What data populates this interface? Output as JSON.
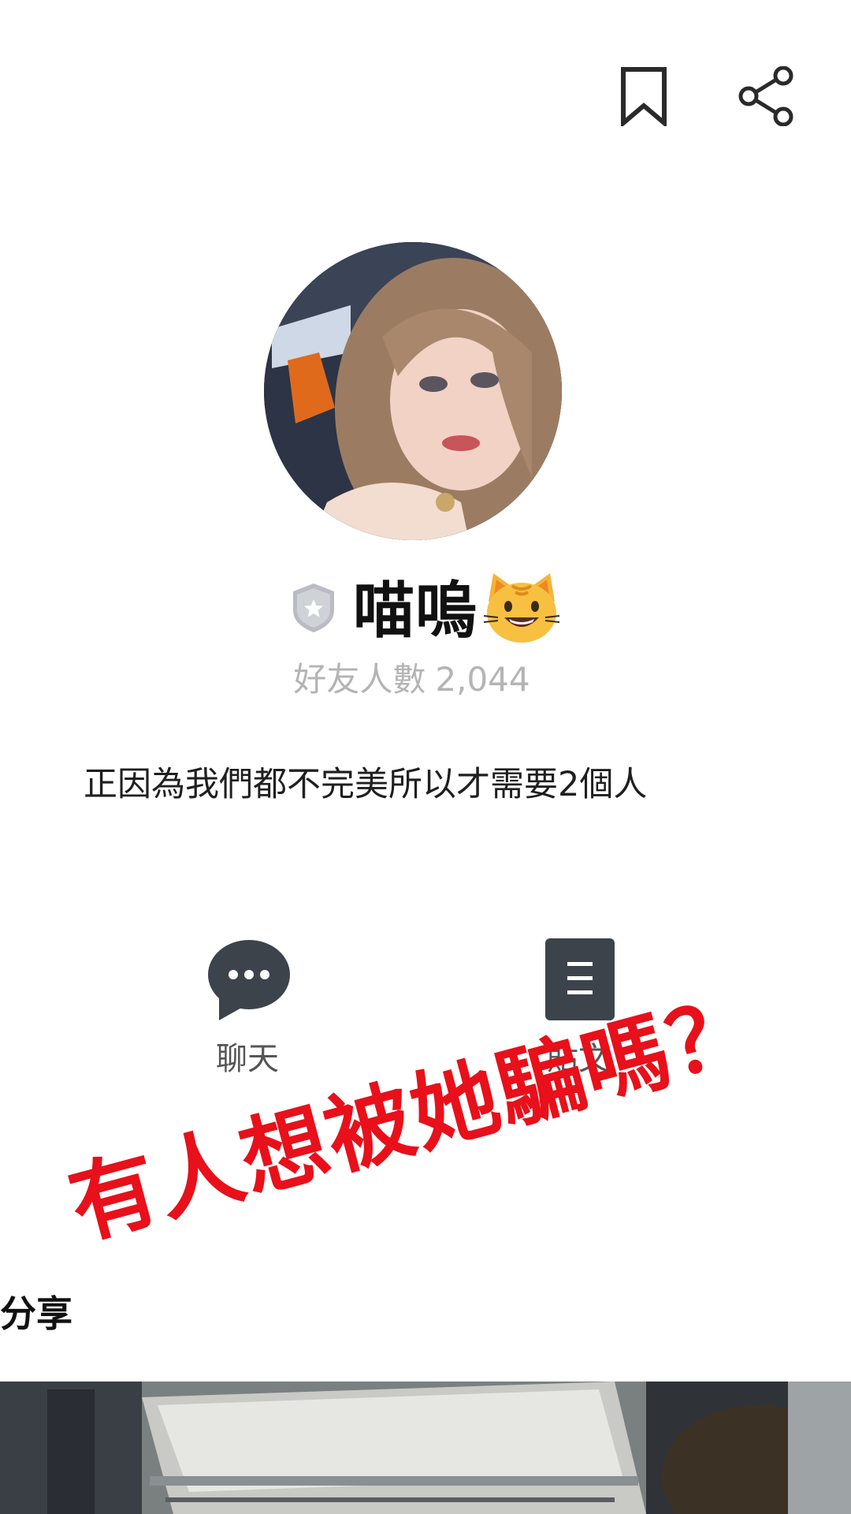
{
  "toolbar": {
    "bookmark_icon": "bookmark-icon",
    "share_icon": "share-icon"
  },
  "profile": {
    "badge_icon": "shield-star-icon",
    "name": "喵嗚",
    "name_emoji": "cat-face-icon",
    "friend_count_label": "好友人數",
    "friend_count_value": "2,044",
    "status_message": "正因為我們都不完美所以才需要2個人"
  },
  "actions": [
    {
      "label": "聊天",
      "icon": "chat-bubble-icon"
    },
    {
      "label": "貼文",
      "icon": "posts-icon"
    }
  ],
  "overlay": {
    "caption": "有人想被她騙嗎？",
    "color": "#e8101a"
  },
  "section": {
    "title": "分享"
  }
}
